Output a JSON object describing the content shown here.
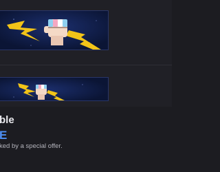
{
  "promo": {
    "title": "ble",
    "word": "E",
    "description": "ked by a special offer."
  },
  "banners": {
    "large": {
      "icon": "lightning-fist-icon"
    },
    "small": {
      "icon": "lightning-fist-icon"
    }
  },
  "colors": {
    "background": "#1c1c21",
    "banner_bg": "#0d1a3e",
    "bolt": "#f2c418",
    "accent": "#4d8ff5"
  }
}
